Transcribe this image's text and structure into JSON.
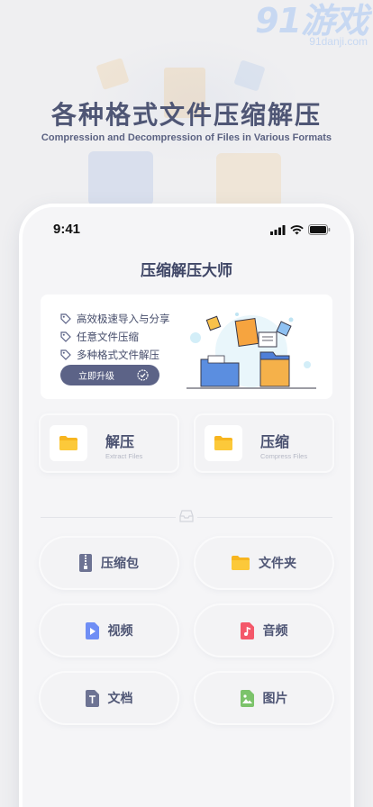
{
  "watermark": {
    "logo": "91游戏",
    "site": "91danji.com"
  },
  "promo": {
    "headline": "各种格式文件压缩解压",
    "subheadline": "Compression and Decompression of Files in Various Formats"
  },
  "status_bar": {
    "time": "9:41"
  },
  "app": {
    "title": "压缩解压大师"
  },
  "banner": {
    "features": [
      "高效极速导入与分享",
      "任意文件压缩",
      "多种格式文件解压"
    ],
    "upgrade_label": "立即升级"
  },
  "cards": [
    {
      "title": "解压",
      "subtitle": "Extract Files",
      "icon": "folder-icon"
    },
    {
      "title": "压缩",
      "subtitle": "Compress Files",
      "icon": "folder-icon"
    }
  ],
  "categories": [
    {
      "label": "压缩包",
      "icon": "zip-archive-icon"
    },
    {
      "label": "文件夹",
      "icon": "folder-icon"
    },
    {
      "label": "视频",
      "icon": "video-file-icon"
    },
    {
      "label": "音频",
      "icon": "audio-file-icon"
    },
    {
      "label": "文档",
      "icon": "text-document-icon"
    },
    {
      "label": "图片",
      "icon": "image-file-icon"
    }
  ],
  "colors": {
    "accent": "#5c6387",
    "folder": "#f9bd2e",
    "video": "#6f8ef5",
    "audio": "#f4586a",
    "doc": "#6d7393",
    "image": "#7cc36b"
  }
}
